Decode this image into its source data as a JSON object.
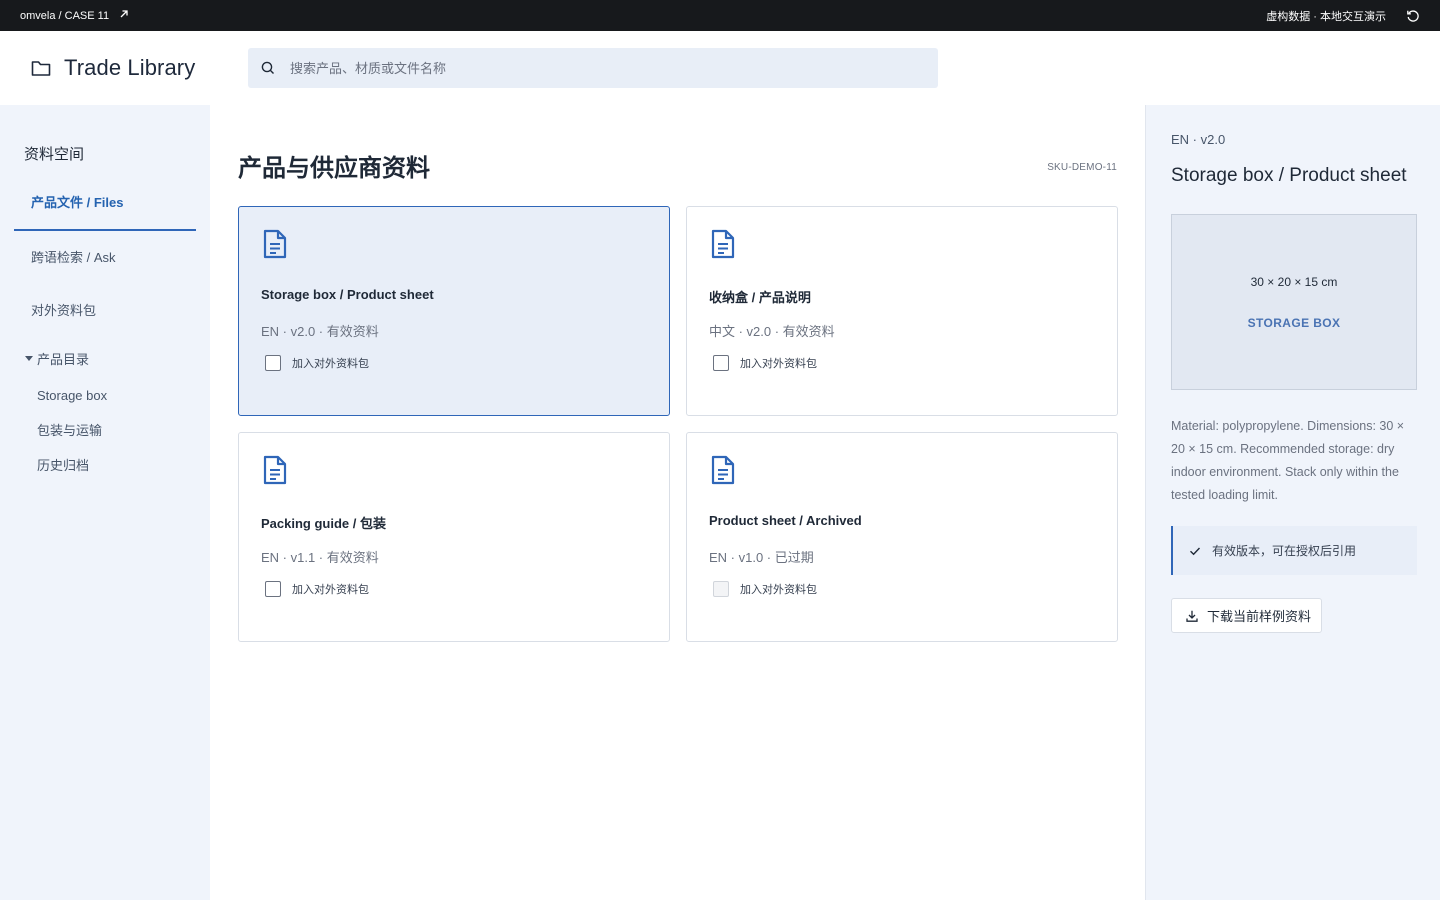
{
  "topbar": {
    "breadcrumb": "omvela / CASE 11",
    "external_icon": "arrow-up-right-icon",
    "mode_label": "虚构数据 · 本地交互演示",
    "refresh_icon": "refresh-icon"
  },
  "header": {
    "app_name": "Trade Library",
    "logo_icon": "folder-icon",
    "search": {
      "placeholder": "搜索产品、材质或文件名称",
      "value": "",
      "icon": "search-icon"
    }
  },
  "sidebar": {
    "section_title": "资料空间",
    "nav": [
      {
        "label": "产品文件 / Files",
        "active": true
      },
      {
        "label": "跨语检索 / Ask",
        "active": false
      },
      {
        "label": "对外资料包",
        "active": false
      }
    ],
    "tree": {
      "label": "产品目录",
      "expanded": true,
      "items": [
        "Storage box",
        "包装与运输",
        "历史归档"
      ]
    }
  },
  "main": {
    "title": "产品与供应商资料",
    "sku": "SKU-DEMO-11",
    "cards": [
      {
        "title": "Storage box / Product sheet",
        "meta": "EN · v2.0 · 有效资料",
        "checkbox_label": "加入对外资料包",
        "checked": false,
        "selected": true,
        "disabled": false
      },
      {
        "title": "收纳盒 / 产品说明",
        "meta": "中文 · v2.0 · 有效资料",
        "checkbox_label": "加入对外资料包",
        "checked": false,
        "selected": false,
        "disabled": false
      },
      {
        "title": "Packing guide / 包装",
        "meta": "EN · v1.1 · 有效资料",
        "checkbox_label": "加入对外资料包",
        "checked": false,
        "selected": false,
        "disabled": false
      },
      {
        "title": "Product sheet / Archived",
        "meta": "EN · v1.0 · 已过期",
        "checkbox_label": "加入对外资料包",
        "checked": false,
        "selected": false,
        "disabled": true
      }
    ]
  },
  "detail": {
    "meta": "EN · v2.0",
    "title": "Storage box / Product sheet",
    "preview": {
      "dimensions": "30 × 20 × 15 cm",
      "label": "STORAGE BOX"
    },
    "description": "Material: polypropylene. Dimensions: 30 × 20 × 15 cm. Recommended storage: dry indoor environment. Stack only within the tested loading limit.",
    "status": "有效版本，可在授权后引用",
    "download_label": "下载当前样例资料"
  },
  "colors": {
    "accent": "#2f66b8",
    "topbar_bg": "#17191c",
    "sidebar_bg": "#f0f4fb",
    "selected_card_bg": "#e8eef8"
  }
}
